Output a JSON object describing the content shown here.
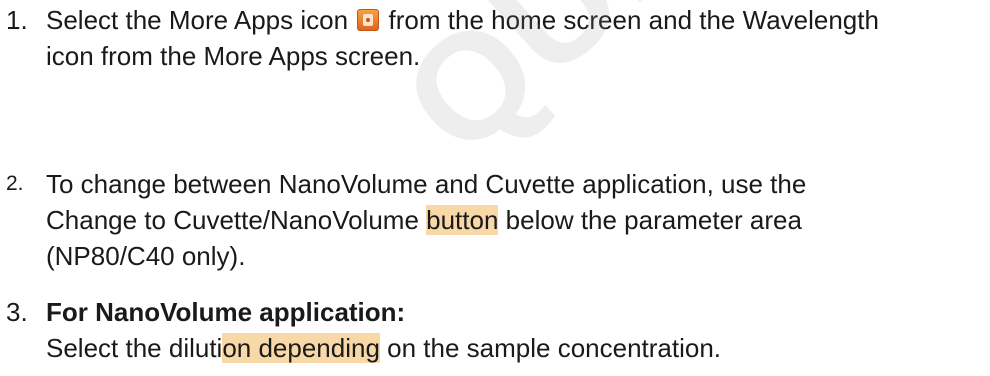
{
  "watermark": "QUE DUT",
  "steps": [
    {
      "number": "1.",
      "line1_before": "Select the More Apps icon",
      "line1_after": "from the home screen and the Wavelength",
      "line2": "icon from the More Apps screen.",
      "icon": "more-apps-icon",
      "icon_color": "#e87424"
    },
    {
      "number": "2.",
      "line1": "To change between NanoVolume and Cuvette application, use the",
      "line2_a": "Change to Cuvette/NanoVolume ",
      "line2_b": "button",
      "line2_c": " below the parameter area",
      "line3": "(NP80/C40 only)."
    },
    {
      "number": "3.",
      "heading": "For NanoVolume application:",
      "line2_a": "Select the diluti",
      "line2_b": "on depending",
      "line2_c": " on the sample concentration."
    }
  ]
}
